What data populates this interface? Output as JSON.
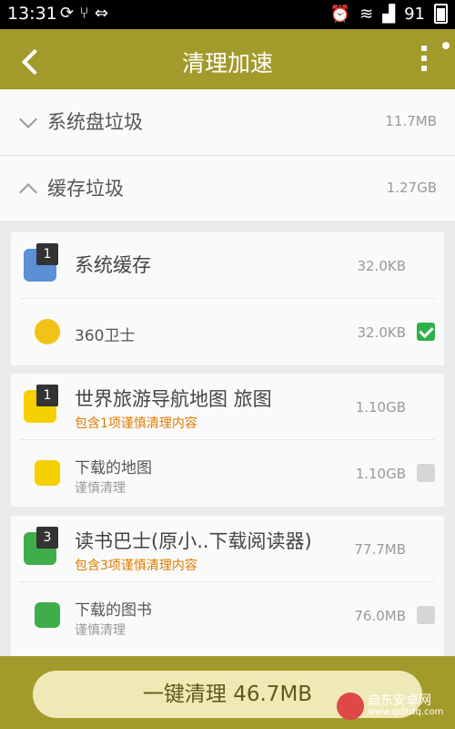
{
  "status": {
    "time": "13:31",
    "battery": "91",
    "left_icons": [
      "sync-icon",
      "usb-share-icon",
      "usb-icon"
    ],
    "right_icons": [
      "alarm-icon",
      "wifi-icon",
      "signal-icon"
    ]
  },
  "header": {
    "title": "清理加速"
  },
  "groups": [
    {
      "label": "系统盘垃圾",
      "size": "11.7MB",
      "expanded": false
    },
    {
      "label": "缓存垃圾",
      "size": "1.27GB",
      "expanded": true
    }
  ],
  "cards": [
    {
      "badge": "1",
      "name": "系统缓存",
      "sub": "",
      "size": "32.0KB",
      "icon_color": "#5b8fd6",
      "items": [
        {
          "name": "360卫士",
          "sub": "",
          "size": "32.0KB",
          "checked": true,
          "icon_color": "#f2c316"
        }
      ]
    },
    {
      "badge": "1",
      "name": "世界旅游导航地图 旅图",
      "sub": "包含1项谨慎清理内容",
      "size": "1.10GB",
      "icon_color": "#f5d000",
      "items": [
        {
          "name": "下载的地图",
          "sub": "谨慎清理",
          "size": "1.10GB",
          "checked": false,
          "icon_color": "#f5d000"
        }
      ]
    },
    {
      "badge": "3",
      "name": "读书巴士(原小..下载阅读器)",
      "sub": "包含3项谨慎清理内容",
      "size": "77.7MB",
      "icon_color": "#3fae4a",
      "items": [
        {
          "name": "下载的图书",
          "sub": "谨慎清理",
          "size": "76.0MB",
          "checked": false,
          "icon_color": "#3fae4a"
        }
      ]
    }
  ],
  "bottom": {
    "clean_label": "一键清理 46.7MB"
  },
  "watermark": {
    "name": "启东安卓网",
    "url": "www.qdltdq.com"
  }
}
